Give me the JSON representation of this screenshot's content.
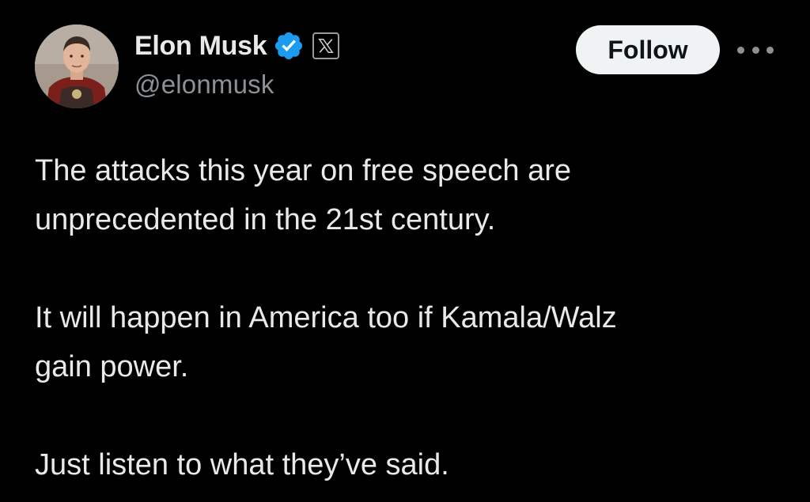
{
  "author": {
    "display_name": "Elon Musk",
    "handle": "@elonmusk",
    "verified_icon": "verified-badge-icon",
    "affiliate_badge_icon": "x-logo-icon",
    "avatar_icon": "avatar-photo"
  },
  "actions": {
    "follow_label": "Follow",
    "more_icon": "more-options-icon"
  },
  "tweet": {
    "paragraphs": [
      [
        "The attacks this year on free speech are",
        "unprecedented in the 21st century."
      ],
      [
        "It will happen in America too if Kamala/Walz",
        "gain power."
      ],
      [
        "Just listen to what they’ve said."
      ]
    ]
  },
  "colors": {
    "background": "#000000",
    "text_primary": "#e7e9ea",
    "text_secondary": "#8b9197",
    "verified_blue": "#1d9bf0",
    "follow_button_bg": "#eff3f4"
  }
}
